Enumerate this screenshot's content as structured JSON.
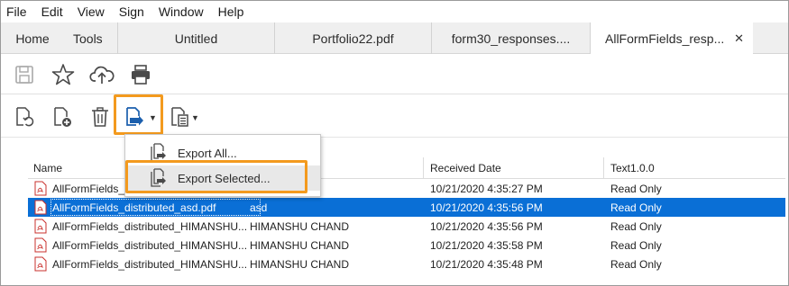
{
  "menubar": {
    "items": [
      "File",
      "Edit",
      "View",
      "Sign",
      "Window",
      "Help"
    ]
  },
  "tabs": {
    "home": "Home",
    "tools": "Tools",
    "docs": [
      "Untitled",
      "Portfolio22.pdf",
      "form30_responses...."
    ],
    "active": "AllFormFields_resp...",
    "close_glyph": "✕"
  },
  "toolbar1": {
    "icons": [
      "save-icon",
      "star-icon",
      "upload-cloud-icon",
      "print-icon"
    ]
  },
  "toolbar2": {
    "icons": [
      "update-icon",
      "add-file-icon",
      "trash-icon",
      "export-icon",
      "document-options-icon"
    ]
  },
  "dropdown": {
    "items": [
      "Export All...",
      "Export Selected..."
    ]
  },
  "table": {
    "headers": [
      "Name",
      "Received Date",
      "Text1.0.0"
    ],
    "rows": [
      {
        "name": "AllFormFields_d",
        "author": "",
        "date": "10/21/2020 4:35:27 PM",
        "text": "Read Only"
      },
      {
        "name": "AllFormFields_distributed_asd.pdf",
        "author": "asd",
        "date": "10/21/2020 4:35:56 PM",
        "text": "Read Only"
      },
      {
        "name": "AllFormFields_distributed_HIMANSHU...",
        "author": "HIMANSHU CHAND",
        "date": "10/21/2020 4:35:56 PM",
        "text": "Read Only"
      },
      {
        "name": "AllFormFields_distributed_HIMANSHU...",
        "author": "HIMANSHU CHAND",
        "date": "10/21/2020 4:35:58 PM",
        "text": "Read Only"
      },
      {
        "name": "AllFormFields_distributed_HIMANSHU...",
        "author": "HIMANSHU CHAND",
        "date": "10/21/2020 4:35:48 PM",
        "text": "Read Only"
      }
    ]
  },
  "colors": {
    "highlight": "#f39a1e",
    "selection": "#0a6fd6",
    "icon_blue": "#1b5fad"
  }
}
